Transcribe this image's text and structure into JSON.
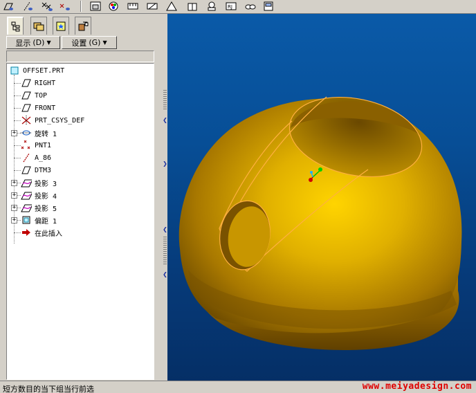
{
  "panel": {
    "show_menu_label": "显示",
    "show_menu_key": "(D)",
    "settings_menu_label": "设置",
    "settings_menu_key": "(G)"
  },
  "tree": {
    "root": "OFFSET.PRT",
    "items": [
      {
        "label": "RIGHT",
        "icon": "datum-plane-icon",
        "expandable": false
      },
      {
        "label": "TOP",
        "icon": "datum-plane-icon",
        "expandable": false
      },
      {
        "label": "FRONT",
        "icon": "datum-plane-icon",
        "expandable": false
      },
      {
        "label": "PRT_CSYS_DEF",
        "icon": "csys-icon",
        "expandable": false
      },
      {
        "label": "旋转 1",
        "icon": "revolve-icon",
        "expandable": true
      },
      {
        "label": "PNT1",
        "icon": "datum-point-icon",
        "expandable": false
      },
      {
        "label": "A_86",
        "icon": "datum-axis-icon",
        "expandable": false
      },
      {
        "label": "DTM3",
        "icon": "datum-plane-icon",
        "expandable": false
      },
      {
        "label": "投影 3",
        "icon": "projection-icon",
        "expandable": true
      },
      {
        "label": "投影 4",
        "icon": "projection-icon",
        "expandable": true
      },
      {
        "label": "投影 5",
        "icon": "projection-icon",
        "expandable": true
      },
      {
        "label": "偏距 1",
        "icon": "offset-icon",
        "expandable": true
      },
      {
        "label": "在此插入",
        "icon": "insert-here-arrow-icon",
        "expandable": false
      }
    ]
  },
  "status": {
    "message": "短方数目的当下组当行前选",
    "watermark": "www.meiyadesign.com"
  },
  "colors": {
    "viewport_top": "#0a5aa8",
    "viewport_bottom": "#052f66",
    "model_gold": "#c8a000",
    "edge_highlight": "#ffb040",
    "watermark": "#e00000"
  }
}
